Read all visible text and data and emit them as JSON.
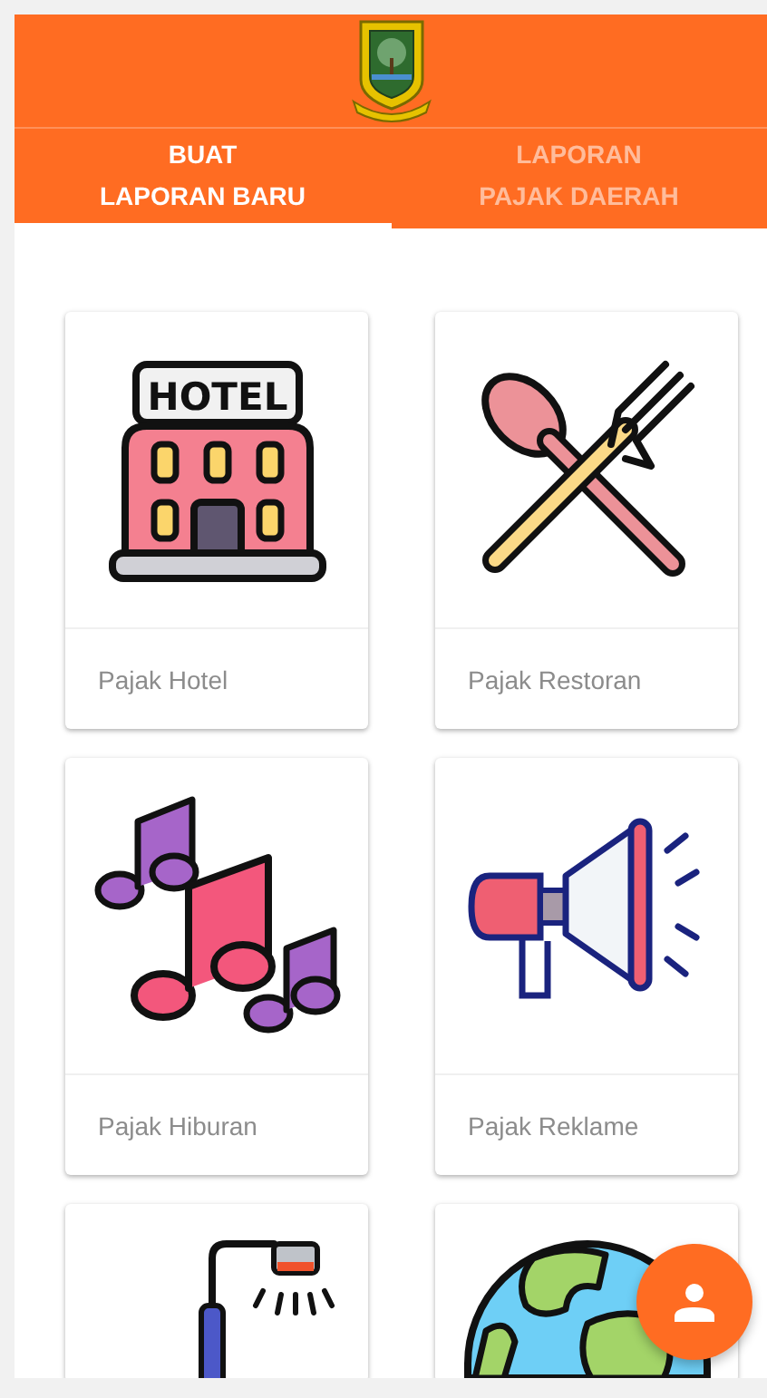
{
  "tabs": [
    {
      "label": "BUAT\nLAPORAN BARU",
      "selected": true
    },
    {
      "label": "LAPORAN\nPAJAK DAERAH",
      "selected": false
    }
  ],
  "cards": [
    {
      "kind": "hotel",
      "sign": "HOTEL",
      "label": "Pajak Hotel"
    },
    {
      "kind": "restaurant",
      "label": "Pajak Restoran"
    },
    {
      "kind": "entertainment",
      "label": "Pajak Hiburan"
    },
    {
      "kind": "billboard",
      "label": "Pajak Reklame"
    },
    {
      "kind": "streetlight"
    },
    {
      "kind": "globe"
    }
  ],
  "fab": {
    "kind": "profile"
  }
}
